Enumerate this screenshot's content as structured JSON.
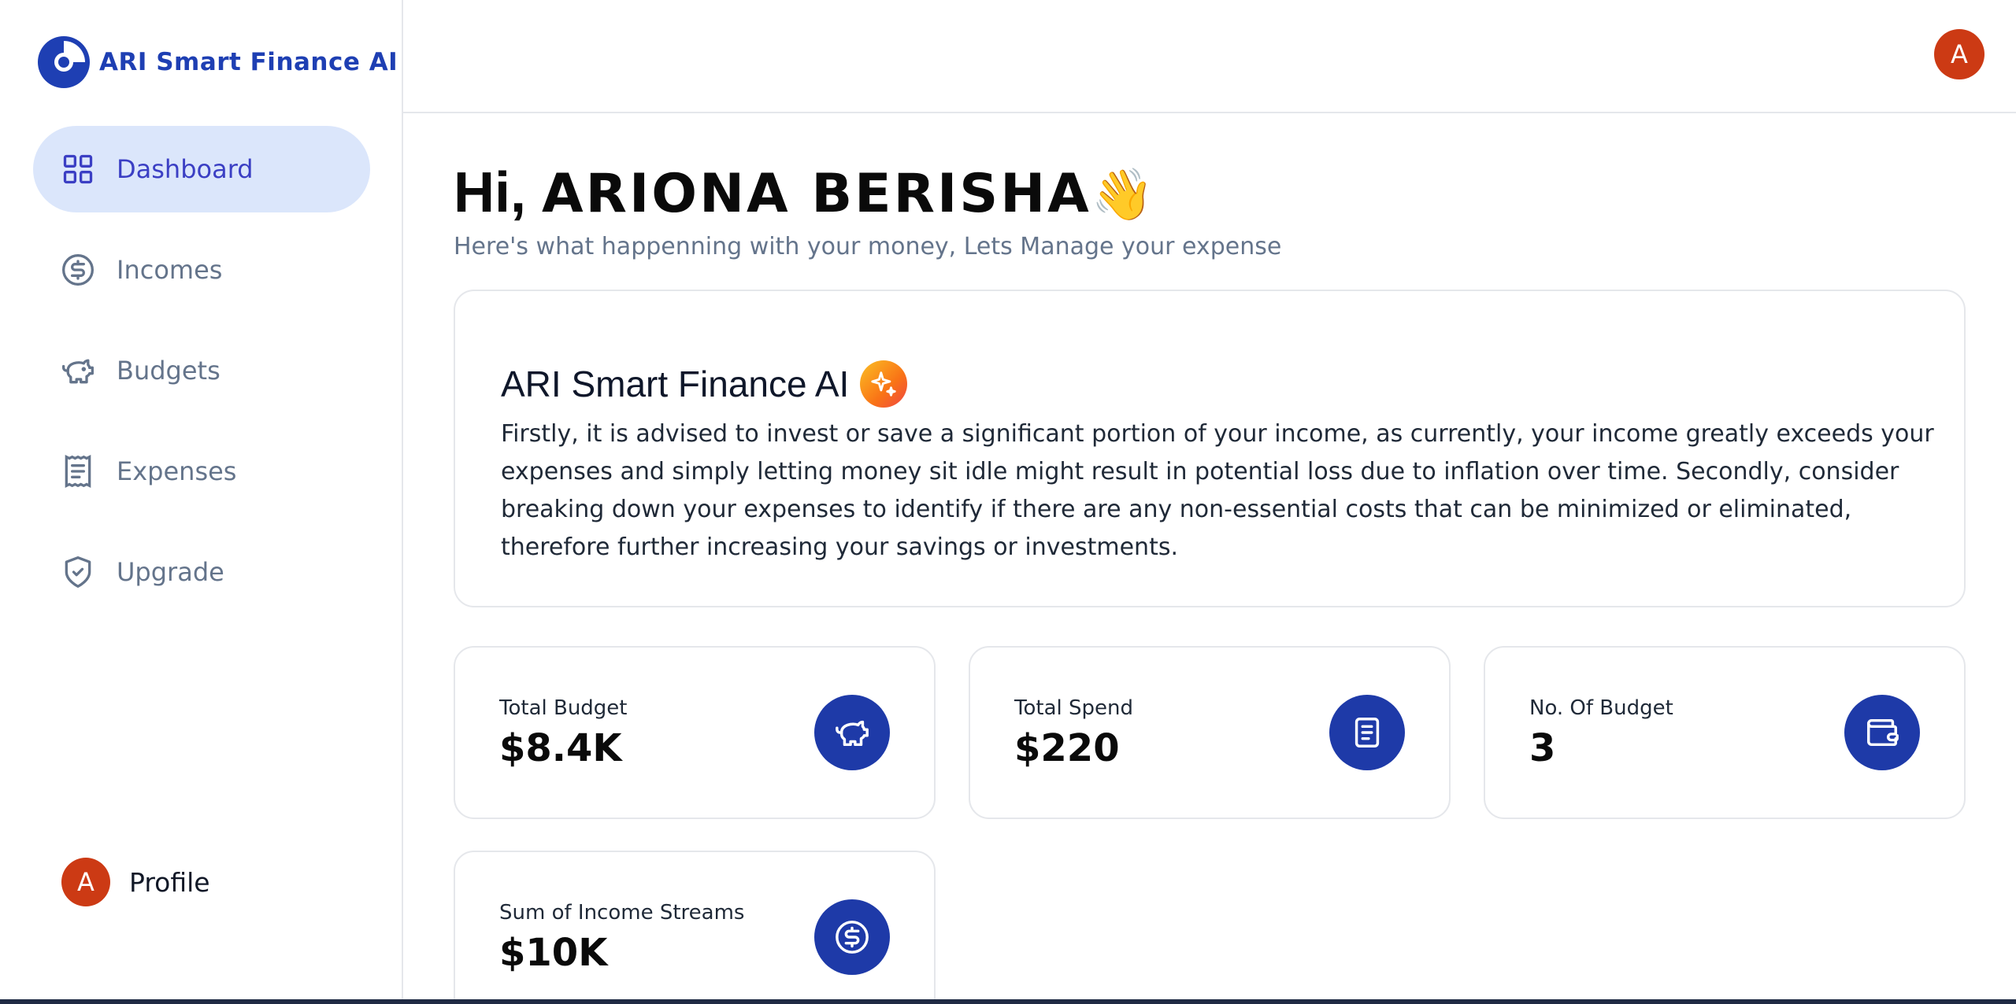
{
  "app": {
    "name": "ARI Smart Finance AI",
    "brand_color": "#1e3fb3"
  },
  "sidebar": {
    "items": [
      {
        "label": "Dashboard",
        "icon": "layout-grid-icon",
        "active": true
      },
      {
        "label": "Incomes",
        "icon": "dollar-circle-icon",
        "active": false
      },
      {
        "label": "Budgets",
        "icon": "piggy-bank-icon",
        "active": false
      },
      {
        "label": "Expenses",
        "icon": "receipt-icon",
        "active": false
      },
      {
        "label": "Upgrade",
        "icon": "shield-check-icon",
        "active": false
      }
    ],
    "profile": {
      "initial": "A",
      "label": "Profile"
    }
  },
  "header": {
    "avatar_initial": "A"
  },
  "main": {
    "greeting_prefix": "Hi, ",
    "greeting_name": "ARIONA BERISHA",
    "greeting_emoji": "👋",
    "subtitle": "Here's what happenning with your money, Lets Manage your expense",
    "ai_card": {
      "title": "ARI Smart Finance AI",
      "text": "Firstly, it is advised to invest or save a significant portion of your income, as currently, your income greatly exceeds your expenses and simply letting money sit idle might result in potential loss due to inflation over time. Secondly, consider breaking down your expenses to identify if there are any non-essential costs that can be minimized or eliminated, therefore further increasing your savings or investments."
    },
    "stats": [
      {
        "label": "Total Budget",
        "value": "$8.4K",
        "icon": "piggy-bank-icon"
      },
      {
        "label": "Total Spend",
        "value": "$220",
        "icon": "receipt-icon"
      },
      {
        "label": "No. Of Budget",
        "value": "3",
        "icon": "wallet-icon"
      },
      {
        "label": "Sum of Income Streams",
        "value": "$10K",
        "icon": "dollar-circle-icon"
      }
    ]
  }
}
